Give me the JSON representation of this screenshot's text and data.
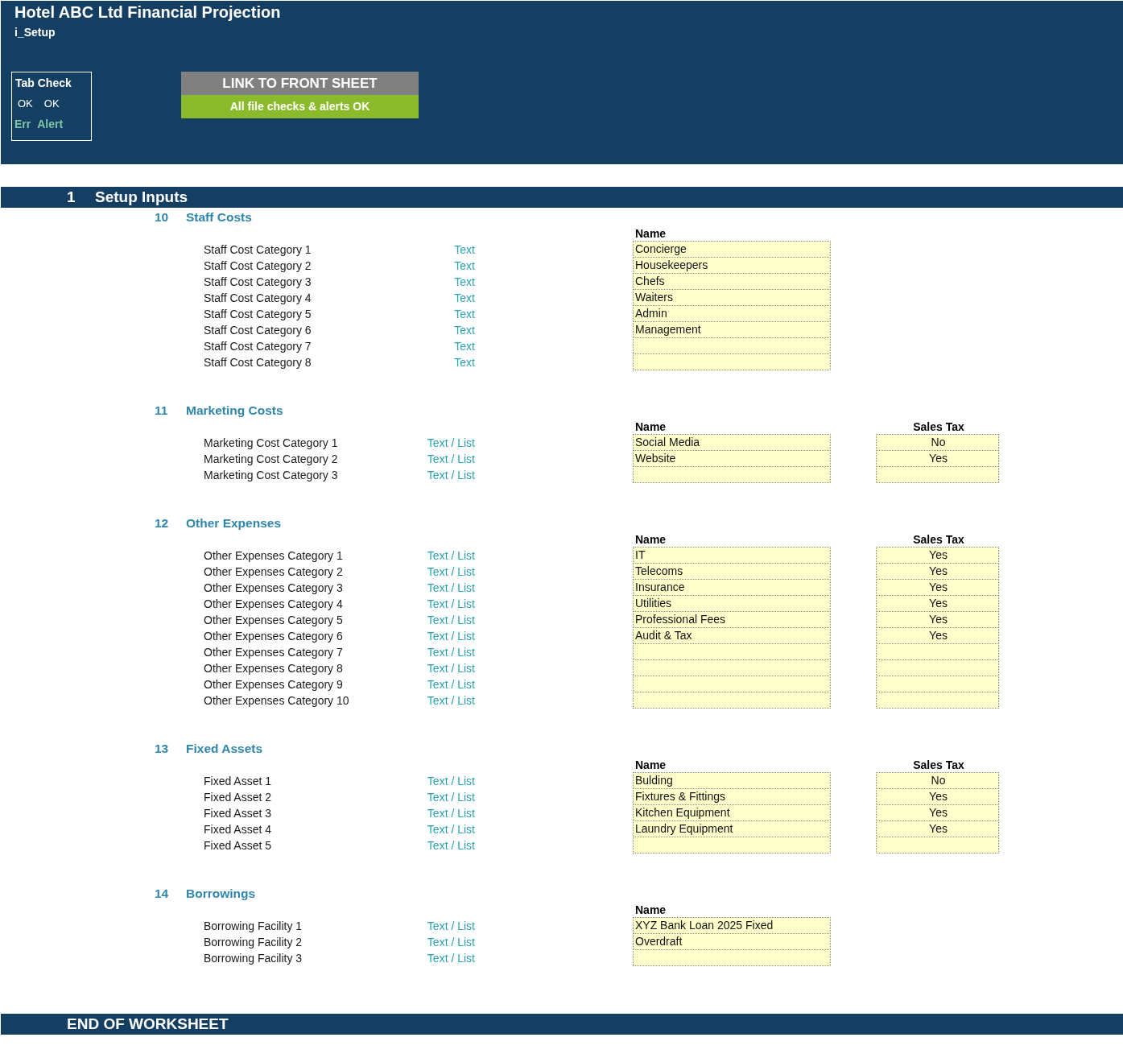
{
  "header": {
    "title": "Hotel ABC Ltd Financial Projection",
    "sheet": "i_Setup",
    "tab_check": {
      "title": "Tab Check",
      "values": [
        "OK",
        "OK"
      ],
      "labels": [
        "Err",
        "Alert"
      ]
    },
    "link_button": "LINK TO FRONT SHEET",
    "status": "All file checks & alerts OK"
  },
  "section": {
    "number": "1",
    "title": "Setup Inputs"
  },
  "groups": [
    {
      "number": "10",
      "title": "Staff Costs",
      "columns": [
        "Name"
      ],
      "rows": [
        {
          "label": "Staff Cost Category 1",
          "type": "Text",
          "name": "Concierge"
        },
        {
          "label": "Staff Cost Category 2",
          "type": "Text",
          "name": "Housekeepers"
        },
        {
          "label": "Staff Cost Category 3",
          "type": "Text",
          "name": "Chefs"
        },
        {
          "label": "Staff Cost Category 4",
          "type": "Text",
          "name": "Waiters"
        },
        {
          "label": "Staff Cost Category 5",
          "type": "Text",
          "name": "Admin"
        },
        {
          "label": "Staff Cost Category 6",
          "type": "Text",
          "name": "Management"
        },
        {
          "label": "Staff Cost Category 7",
          "type": "Text"
        },
        {
          "label": "Staff Cost Category 8",
          "type": "Text"
        }
      ]
    },
    {
      "number": "11",
      "title": "Marketing Costs",
      "columns": [
        "Name",
        "Sales Tax"
      ],
      "rows": [
        {
          "label": "Marketing Cost Category 1",
          "type": "Text / List",
          "name": "Social Media",
          "sales_tax": "No"
        },
        {
          "label": "Marketing Cost Category 2",
          "type": "Text / List",
          "name": "Website",
          "sales_tax": "Yes"
        },
        {
          "label": "Marketing Cost Category 3",
          "type": "Text / List"
        }
      ]
    },
    {
      "number": "12",
      "title": "Other Expenses",
      "columns": [
        "Name",
        "Sales Tax"
      ],
      "rows": [
        {
          "label": "Other Expenses Category 1",
          "type": "Text / List",
          "name": "IT",
          "sales_tax": "Yes"
        },
        {
          "label": "Other Expenses Category 2",
          "type": "Text / List",
          "name": "Telecoms",
          "sales_tax": "Yes"
        },
        {
          "label": "Other Expenses Category 3",
          "type": "Text / List",
          "name": "Insurance",
          "sales_tax": "Yes"
        },
        {
          "label": "Other Expenses Category 4",
          "type": "Text / List",
          "name": "Utilities",
          "sales_tax": "Yes"
        },
        {
          "label": "Other Expenses Category 5",
          "type": "Text / List",
          "name": "Professional Fees",
          "sales_tax": "Yes"
        },
        {
          "label": "Other Expenses Category 6",
          "type": "Text / List",
          "name": "Audit & Tax",
          "sales_tax": "Yes"
        },
        {
          "label": "Other Expenses Category 7",
          "type": "Text / List"
        },
        {
          "label": "Other Expenses Category 8",
          "type": "Text / List"
        },
        {
          "label": "Other Expenses Category 9",
          "type": "Text / List"
        },
        {
          "label": "Other Expenses Category 10",
          "type": "Text / List"
        }
      ]
    },
    {
      "number": "13",
      "title": "Fixed Assets",
      "columns": [
        "Name",
        "Sales Tax"
      ],
      "rows": [
        {
          "label": "Fixed Asset 1",
          "type": "Text / List",
          "name": "Bulding",
          "sales_tax": "No"
        },
        {
          "label": "Fixed Asset 2",
          "type": "Text / List",
          "name": "Fixtures & Fittings",
          "sales_tax": "Yes"
        },
        {
          "label": "Fixed Asset 3",
          "type": "Text / List",
          "name": "Kitchen Equipment",
          "sales_tax": "Yes"
        },
        {
          "label": "Fixed Asset 4",
          "type": "Text / List",
          "name": "Laundry Equipment",
          "sales_tax": "Yes"
        },
        {
          "label": "Fixed Asset 5",
          "type": "Text / List"
        }
      ]
    },
    {
      "number": "14",
      "title": "Borrowings",
      "columns": [
        "Name"
      ],
      "rows": [
        {
          "label": "Borrowing Facility 1",
          "type": "Text / List",
          "name": "XYZ Bank Loan 2025 Fixed"
        },
        {
          "label": "Borrowing Facility 2",
          "type": "Text / List",
          "name": "Overdraft"
        },
        {
          "label": "Borrowing Facility 3",
          "type": "Text / List"
        }
      ]
    }
  ],
  "footer": "END OF WORKSHEET"
}
